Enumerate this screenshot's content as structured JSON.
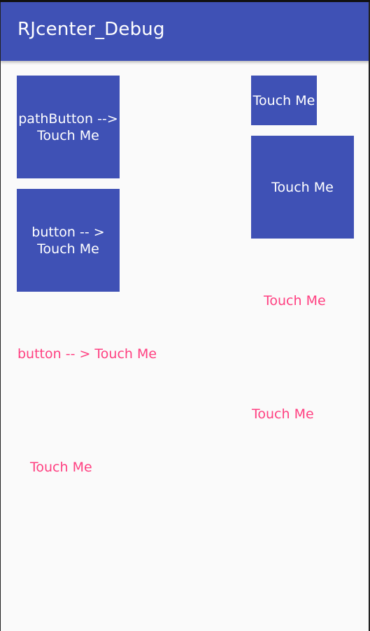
{
  "app_bar": {
    "title": "RJcenter_Debug"
  },
  "buttons": {
    "path_button": "pathButton -->\nTouch Me",
    "button_arrow_box": "button -- >\nTouch Me",
    "touch_small": "Touch Me",
    "touch_large": "Touch Me",
    "touch_text_1": "Touch Me",
    "button_arrow_text": "button -- > Touch Me",
    "touch_text_2": "Touch Me",
    "touch_text_3": "Touch Me"
  },
  "colors": {
    "primary": "#3f51b5",
    "accent": "#ff4081",
    "background": "#fafafa"
  }
}
